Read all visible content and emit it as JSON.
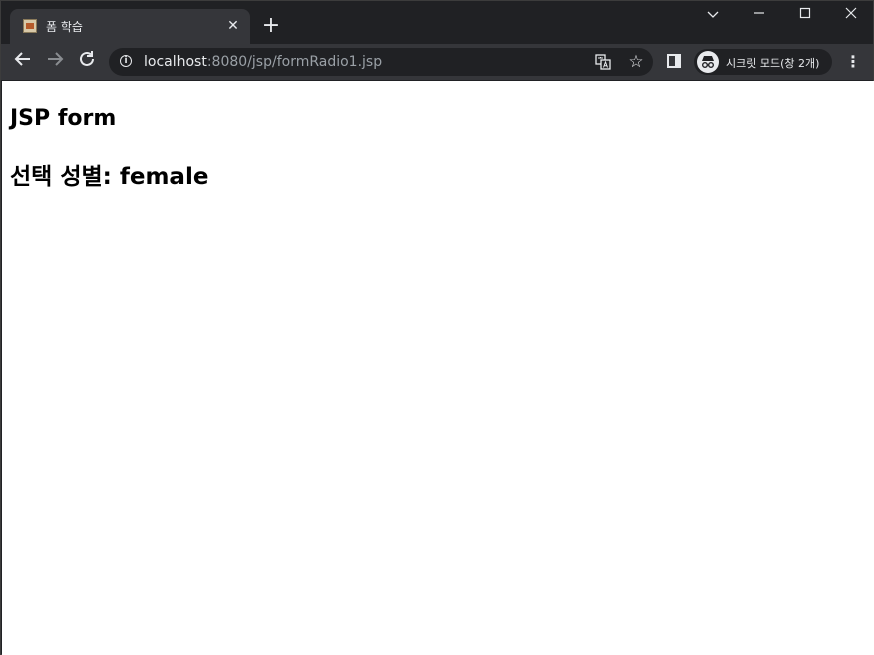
{
  "browser": {
    "tab": {
      "title": "폼 학습",
      "close_label": "✕"
    },
    "new_tab_label": "+",
    "window_controls": {
      "dropdown": "⌵",
      "minimize": "—",
      "maximize": "☐",
      "close": "✕"
    },
    "address": {
      "host": "localhost",
      "rest": ":8080/jsp/formRadio1.jsp"
    },
    "incognito_label": "시크릿 모드(창 2개)",
    "icons": {
      "back": "back-arrow-icon",
      "forward": "forward-arrow-icon",
      "reload": "reload-icon",
      "info": "info-icon",
      "translate": "translate-icon",
      "bookmark": "star-icon",
      "side_panel": "side-panel-icon",
      "incognito": "incognito-icon",
      "menu": "kebab-menu-icon"
    }
  },
  "page": {
    "title": "JSP form",
    "result": "선택 성별: female"
  }
}
